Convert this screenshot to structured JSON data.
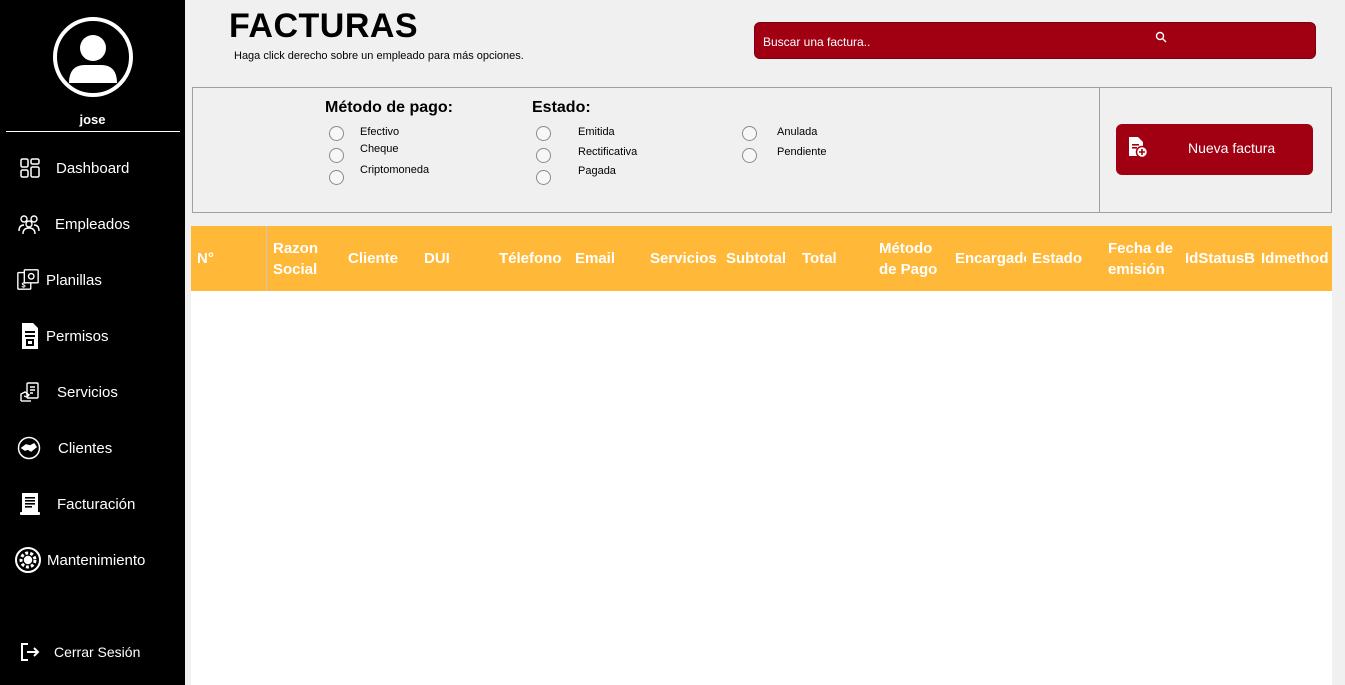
{
  "user": {
    "name": "jose"
  },
  "sidebar": {
    "items": [
      {
        "label": "Dashboard",
        "icon": "dashboard-icon"
      },
      {
        "label": "Empleados",
        "icon": "employees-icon"
      },
      {
        "label": "Planillas",
        "icon": "payroll-icon"
      },
      {
        "label": "Permisos",
        "icon": "permissions-icon"
      },
      {
        "label": "Servicios",
        "icon": "services-icon"
      },
      {
        "label": "Clientes",
        "icon": "clients-icon"
      },
      {
        "label": "Facturación",
        "icon": "billing-icon"
      },
      {
        "label": "Mantenimiento",
        "icon": "maintenance-icon"
      }
    ],
    "logout": "Cerrar Sesión"
  },
  "header": {
    "title": "FACTURAS",
    "subtitle": "Haga click derecho sobre un empleado para más opciones."
  },
  "search": {
    "placeholder": "Buscar una factura.."
  },
  "filters": {
    "payment_title": "Método de pago:",
    "payment_options": [
      "Efectivo",
      "Cheque",
      "Criptomoneda"
    ],
    "status_title": "Estado:",
    "status_options": [
      "Emitida",
      "Rectificativa",
      "Pagada",
      "Anulada",
      "Pendiente"
    ]
  },
  "actions": {
    "new_invoice": "Nueva factura"
  },
  "table": {
    "columns": [
      "N°",
      "Razon Social",
      "Cliente",
      "DUI",
      "Télefono",
      "Email",
      "Servicios",
      "Subtotal",
      "Total",
      "Método de Pago",
      "Encargado",
      "Estado",
      "Fecha de emisión",
      "IdStatusBill",
      "Idmethod"
    ],
    "rows": []
  },
  "colors": {
    "sidebar_bg": "#000000",
    "accent_red": "#a00012",
    "table_header": "#ffb838",
    "page_bg": "#f0f0f0"
  }
}
